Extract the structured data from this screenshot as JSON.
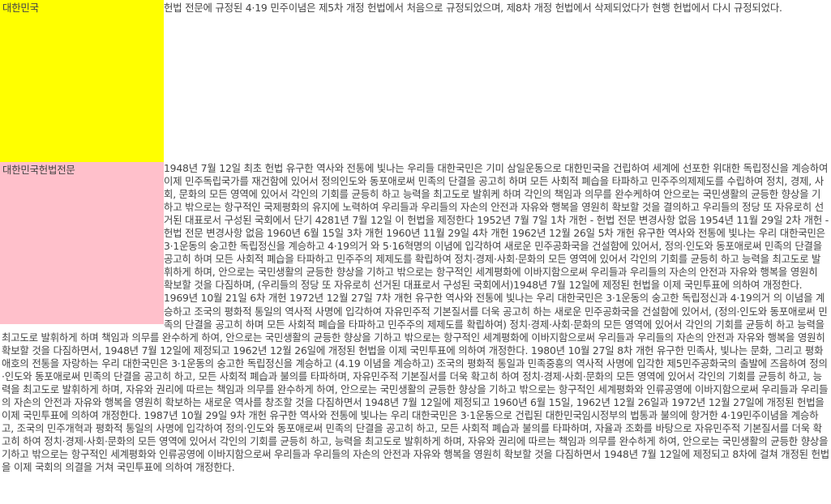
{
  "sections": [
    {
      "label": "대한민국",
      "label_bg": "#ffff00",
      "text": "헌법 전문에 규정된 4·19 민주이념은 제5차 개정 헌법에서 처음으로 규정되었으며, 제8차 개정 헌법에서 삭제되었다가 현행 헌법에서 다시 규정되었다."
    },
    {
      "label": "대한민국헌법전문",
      "label_bg": "#ffc0cb",
      "text": "1948년 7월 12일 최초 헌법 유구한 역사와 전통에 빛나는 우리들 대한국민은 기미 삼일운동으로 대한민국을 건립하여 세계에 선포한 위대한 독립정신을 계승하여 이제 민주독립국가를 재건함에 있어서 정의인도와 동포애로써 민족의 단결을 공고히 하며 모든 사회적 폐습을 타파하고 민주주의제제도를 수립하여 정치, 경제, 사회, 문화의 모든 영역에 있어서 각인의 기회를 균등히 하고 능력을 최고도로 발휘케 하며 각인의 책임과 의무를 완수케하여 안으로는 국민생활의 균등한 향상을 기하고 밖으로는 항구적인 국제평화의 유지에 노력하여 우리들과 우리들의 자손의 안전과 자유와 행복을 영원히 확보할 것을 결의하고 우리들의 정당 또 자유로히 선거된 대표로서 구성된 국회에서 단기 4281년 7월 12일 이 헌법을 제정한다 1952년 7월 7일 1차 개헌 - 헌법 전문 변경사항 없음 1954년 11월 29일 2차 개헌 - 헌법 전문 변경사항 없음 1960년 6월 15일 3차 개헌 1960년 11월 29일 4차 개헌 1962년 12월 26일 5차 개헌 유구한 역사와 전통에 빛나는 우리 대한국민은 3·1운동의 숭고한 독립정신을 계승하고 4·19의거 와 5·16혁명의 이념에 입각하여 새로운 민주공화국을 건설함에 있어서, 정의·인도와 동포애로써 민족의 단결을 공고히 하며 모든 사회적 폐습을 타파하고 민주주의 제제도를 확립하여 정치·경제·사회·문화의 모든 영역에 있어서 각인의 기회를 균등히 하고 능력을 최고도로 발휘하게 하며, 안으로는 국민생활의 균등한 향상을 기하고 밖으로는 항구적인 세계평화에 이바지함으로써 우리들과 우리들의 자손의 안전과 자유와 행복을 영원히 확보할 것을 다짐하며, (우리들의 정당 또 자유로히 선거된 대표로서 구성된 국회에서)1948년 7월 12일에 제정된 헌법을 이제 국민투표에 의하여 개정한다. 1969년 10월 21일 6차 개헌 1972년 12월 27일 7차 개헌 유구한 역사와 전통에 빛나는 우리 대한국민은 3·1운동의 숭고한 독립정신과 4·19의거 의 이념을 계승하고 조국의 평화적 통일의 역사적 사명에 입각하여 자유민주적 기본질서를 더욱 공고히 하는 새로운 민주공화국을 건설함에 있어서, (정의·인도와 동포애로써 민족의 단결을 공고히 하며 모든 사회적 폐습을 타파하고 민주주의 제제도를 확립하여) 정치·경제·사회·문화의 모든 영역에 있어서 각인의 기회를 균등히 하고 능력을 최고도로 발휘하게 하며 책임과 의무를 완수하게 하여, 안으로는 국민생활의 균등한 향상을 기하고 밖으로는 항구적인 세계평화에 이바지함으로써 우리들과 우리들의 자손의 안전과 자유와 행복을 영원히 확보할 것을 다짐하면서, 1948년 7월 12일에 제정되고 1962년 12월 26일에 개정된 헌법을 이제 국민투표에 의하여 개정한다. 1980년 10월 27일 8차 개헌 유구한 민족사, 빛나는 문화, 그리고 평화애호의 전통을 자랑하는 우리 대한국민은 3·1운동의 숭고한 독립정신을 계승하고 (4.19 이념을 계승하고) 조국의 평화적 통일과 민족중흥의 역사적 사명에 입각한 제5민주공화국의 출발에 즈음하여 정의·인도와 동포애로써 민족의 단결을 공고히 하고, 모든 사회적 폐습과 불의를 타파하며, 자유민주적 기본질서를 더욱 확고히 하여 정치·경제·사회·문화의 모든 영역에 있어서 각인의 기회를 균등히 하고, 능력을 최고도로 발휘하게 하며, 자유와 권리에 따르는 책임과 의무를 완수하게 하여, 안으로는 국민생활의 균등한 향상을 기하고 밖으로는 항구적인 세계평화와 인류공영에 이바지함으로써 우리들과 우리들의 자손의 안전과 자유와 행복을 영원히 확보하는 새로운 역사를 창조할 것을 다짐하면서 1948년 7월 12일에 제정되고 1960년 6월 15일, 1962년 12월 26일과 1972년 12월 27일에 개정된 헌법을 이제 국민투표에 의하여 개정한다. 1987년 10월 29일 9차 개헌 유구한 역사와 전통에 빛나는 우리 대한국민은 3·1운동으로 건립된 대한민국임시정부의 법통과 불의에 항거한 4·19민주이념을 계승하고, 조국의 민주개혁과 평화적 통일의 사명에 입각하여 정의·인도와 동포애로써 민족의 단결을 공고히 하고, 모든 사회적 폐습과 불의를 타파하며, 자율과 조화를 바탕으로 자유민주적 기본질서를 더욱 확고히 하여 정치·경제·사회·문화의 모든 영역에 있어서 각인의 기회를 균등히 하고, 능력을 최고도로 발휘하게 하며, 자유와 권리에 따르는 책임과 의무를 완수하게 하여, 안으로는 국민생활의 균등한 향상을 기하고 밖으로는 항구적인 세계평화와 인류공영에 이바지함으로써 우리들과 우리들의 자손의 안전과 자유와 행복을 영원히 확보할 것을 다짐하면서 1948년 7월 12일에 제정되고 8차에 걸쳐 개정된 헌법을 이제 국회의 의결을 거쳐 국민투표에 의하여 개정한다."
    }
  ]
}
